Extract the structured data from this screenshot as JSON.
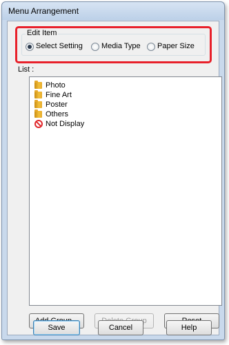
{
  "window": {
    "title": "Menu Arrangement"
  },
  "edit_item": {
    "legend": "Edit Item",
    "options": [
      {
        "label": "Select Setting",
        "checked": true
      },
      {
        "label": "Media Type",
        "checked": false
      },
      {
        "label": "Paper Size",
        "checked": false
      }
    ]
  },
  "list": {
    "label": "List :",
    "items": [
      {
        "label": "Photo",
        "icon": "folder-icon"
      },
      {
        "label": "Fine Art",
        "icon": "folder-icon"
      },
      {
        "label": "Poster",
        "icon": "folder-icon"
      },
      {
        "label": "Others",
        "icon": "folder-icon"
      },
      {
        "label": "Not Display",
        "icon": "no-entry-icon"
      }
    ]
  },
  "list_buttons": {
    "add_group": "Add Group...",
    "delete_group": "Delete Group",
    "delete_group_enabled": false,
    "reset": "Reset"
  },
  "footer_buttons": {
    "save": "Save",
    "cancel": "Cancel",
    "help": "Help"
  },
  "colors": {
    "highlight_border": "#e8202a",
    "title_bar": "#c9d9ec"
  }
}
